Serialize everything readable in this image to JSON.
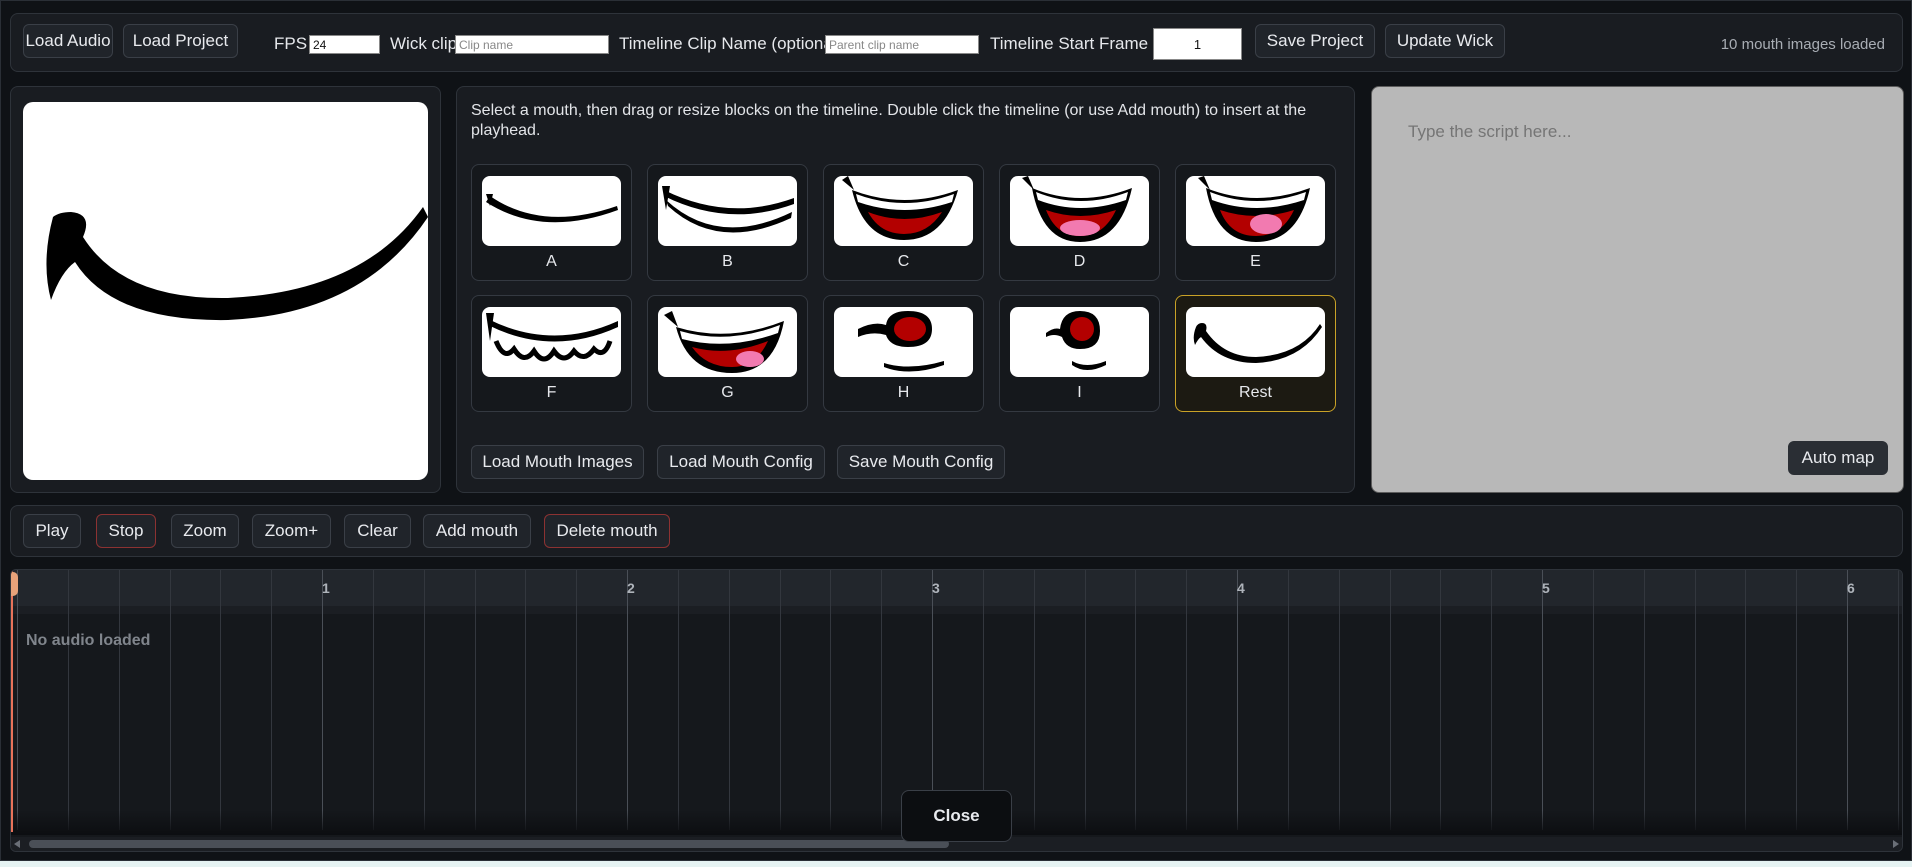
{
  "toolbar": {
    "load_audio": "Load Audio",
    "load_project": "Load Project",
    "fps_label": "FPS",
    "fps_value": "24",
    "wick_clip_label": "Wick clip",
    "wick_clip_placeholder": "Clip name",
    "timeline_clip_label": "Timeline Clip Name (optional)",
    "timeline_clip_placeholder": "Parent clip name",
    "start_frame_label": "Timeline Start Frame",
    "start_frame_value": "1",
    "save_project": "Save Project",
    "update_wick": "Update Wick",
    "status": "10 mouth images loaded"
  },
  "mouth_panel": {
    "instructions": "Select a mouth, then drag or resize blocks on the timeline. Double click the timeline (or use Add mouth) to insert at the playhead.",
    "mouths": [
      {
        "label": "A",
        "icon": "mouth-a-icon"
      },
      {
        "label": "B",
        "icon": "mouth-b-icon"
      },
      {
        "label": "C",
        "icon": "mouth-c-icon"
      },
      {
        "label": "D",
        "icon": "mouth-d-icon"
      },
      {
        "label": "E",
        "icon": "mouth-e-icon"
      },
      {
        "label": "F",
        "icon": "mouth-f-icon"
      },
      {
        "label": "G",
        "icon": "mouth-g-icon"
      },
      {
        "label": "H",
        "icon": "mouth-h-icon"
      },
      {
        "label": "I",
        "icon": "mouth-i-icon"
      },
      {
        "label": "Rest",
        "icon": "mouth-rest-icon",
        "selected": true
      }
    ],
    "load_images": "Load Mouth Images",
    "load_config": "Load Mouth Config",
    "save_config": "Save Mouth Config"
  },
  "script": {
    "placeholder": "Type the script here...",
    "auto_map": "Auto map"
  },
  "controls": {
    "play": "Play",
    "stop": "Stop",
    "zoom_out": "Zoom",
    "zoom_in": "Zoom+",
    "clear": "Clear",
    "add_mouth": "Add mouth",
    "delete_mouth": "Delete mouth"
  },
  "timeline": {
    "seconds": [
      "1",
      "2",
      "3",
      "4",
      "5",
      "6"
    ],
    "empty_text": "No audio loaded"
  },
  "dialog": {
    "close": "Close"
  },
  "colors": {
    "accent": "#c9a227",
    "danger": "#8c3232",
    "playhead": "#e8735a",
    "lip_red": "#b30000",
    "tongue": "#f27ab0"
  }
}
